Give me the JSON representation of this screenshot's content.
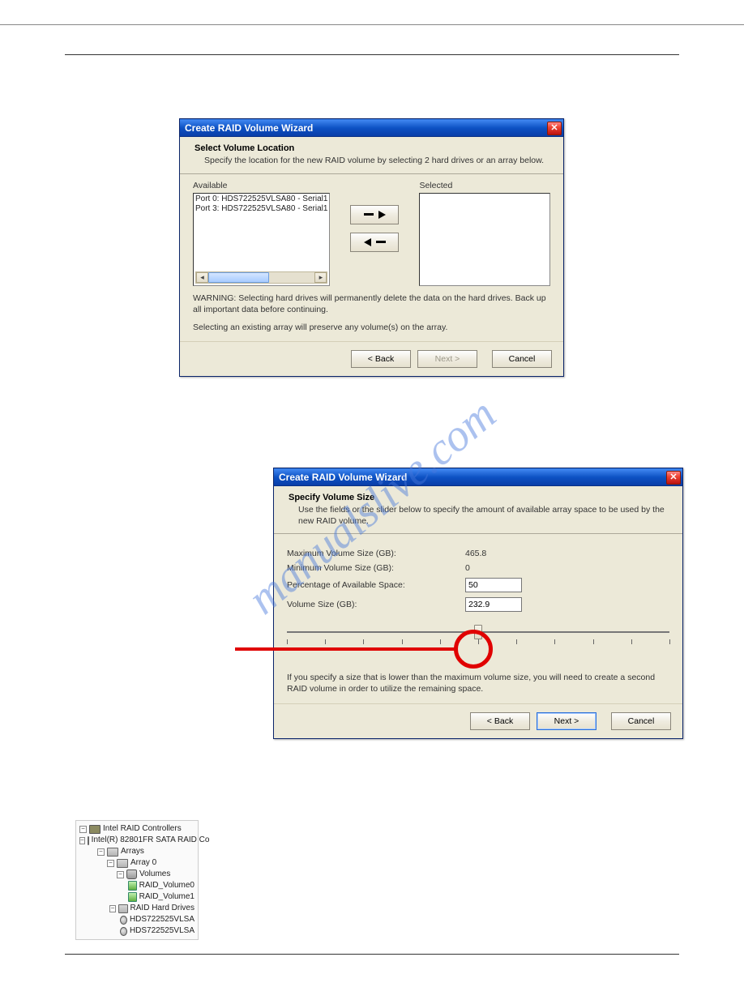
{
  "watermark": "manualslive.com",
  "dialog1": {
    "title": "Create RAID Volume Wizard",
    "header_title": "Select Volume Location",
    "header_desc": "Specify the location for the new RAID volume by selecting 2 hard drives or an array below.",
    "available_label": "Available",
    "selected_label": "Selected",
    "available_items": [
      "Port 0: HDS722525VLSA80 - Serial1",
      "Port 3: HDS722525VLSA80 - Serial1"
    ],
    "warning": "WARNING: Selecting hard drives will permanently delete the data on the hard drives. Back up all important data before continuing.",
    "preserve_note": "Selecting an existing array will preserve any volume(s) on the array.",
    "btn_back": "< Back",
    "btn_next": "Next >",
    "btn_cancel": "Cancel"
  },
  "dialog2": {
    "title": "Create RAID Volume Wizard",
    "header_title": "Specify Volume Size",
    "header_desc": "Use the fields or the slider below to specify the amount of available array space to be used by the new RAID volume.",
    "fields": {
      "max_label": "Maximum Volume Size (GB):",
      "max_value": "465.8",
      "min_label": "Minimum Volume Size (GB):",
      "min_value": "0",
      "pct_label": "Percentage of Available Space:",
      "pct_value": "50",
      "vol_label": "Volume Size (GB):",
      "vol_value": "232.9"
    },
    "slider_percent": 50,
    "footer_note": "If you specify a size that is lower than the maximum volume size, you will need to create a second RAID volume in order to utilize the remaining space.",
    "btn_back": "< Back",
    "btn_next": "Next >",
    "btn_cancel": "Cancel"
  },
  "tree": {
    "root": "Intel RAID Controllers",
    "controller": "Intel(R) 82801FR SATA RAID Co",
    "arrays": "Arrays",
    "array0": "Array 0",
    "volumes": "Volumes",
    "vol0": "RAID_Volume0",
    "vol1": "RAID_Volume1",
    "hds": "RAID Hard Drives",
    "hd0": "HDS722525VLSA",
    "hd1": "HDS722525VLSA"
  }
}
